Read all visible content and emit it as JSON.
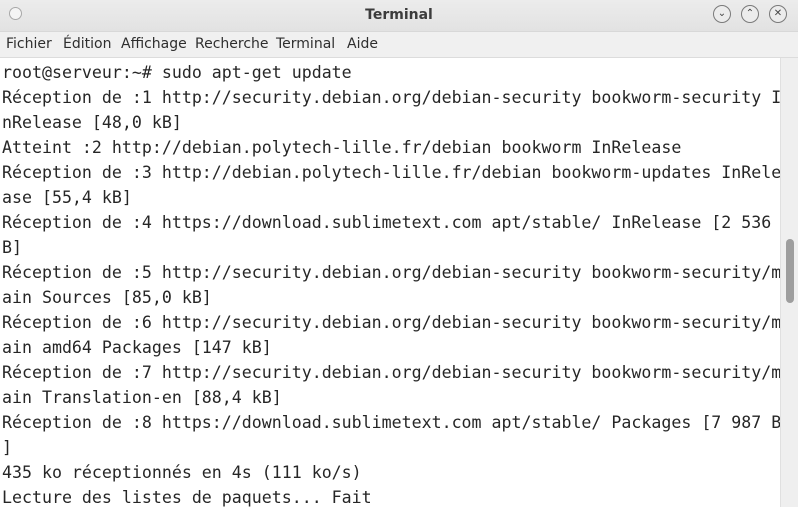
{
  "window": {
    "title": "Terminal",
    "buttons": {
      "minimize_icon": "chevron-down-icon",
      "maximize_icon": "chevron-up-icon",
      "close_icon": "close-icon",
      "minimize_glyph": "⌄",
      "maximize_glyph": "⌃",
      "close_glyph": "✕"
    }
  },
  "menu": {
    "items": [
      "Fichier",
      "Édition",
      "Affichage",
      "Recherche",
      "Terminal",
      "Aide"
    ]
  },
  "terminal": {
    "lines": [
      "root@serveur:~# sudo apt-get update",
      "Réception de :1 http://security.debian.org/debian-security bookworm-security I",
      "nRelease [48,0 kB]",
      "Atteint :2 http://debian.polytech-lille.fr/debian bookworm InRelease",
      "Réception de :3 http://debian.polytech-lille.fr/debian bookworm-updates InRele",
      "ase [55,4 kB]",
      "Réception de :4 https://download.sublimetext.com apt/stable/ InRelease [2 536",
      "B]",
      "Réception de :5 http://security.debian.org/debian-security bookworm-security/m",
      "ain Sources [85,0 kB]",
      "Réception de :6 http://security.debian.org/debian-security bookworm-security/m",
      "ain amd64 Packages [147 kB]",
      "Réception de :7 http://security.debian.org/debian-security bookworm-security/m",
      "ain Translation-en [88,4 kB]",
      "Réception de :8 https://download.sublimetext.com apt/stable/ Packages [7 987 B",
      "]",
      "435 ko réceptionnés en 4s (111 ko/s)",
      "Lecture des listes de paquets... Fait"
    ]
  },
  "colors": {
    "terminal_background": "#ffffff",
    "terminal_text": "#262626",
    "chrome_background": "#f0f0f0"
  }
}
